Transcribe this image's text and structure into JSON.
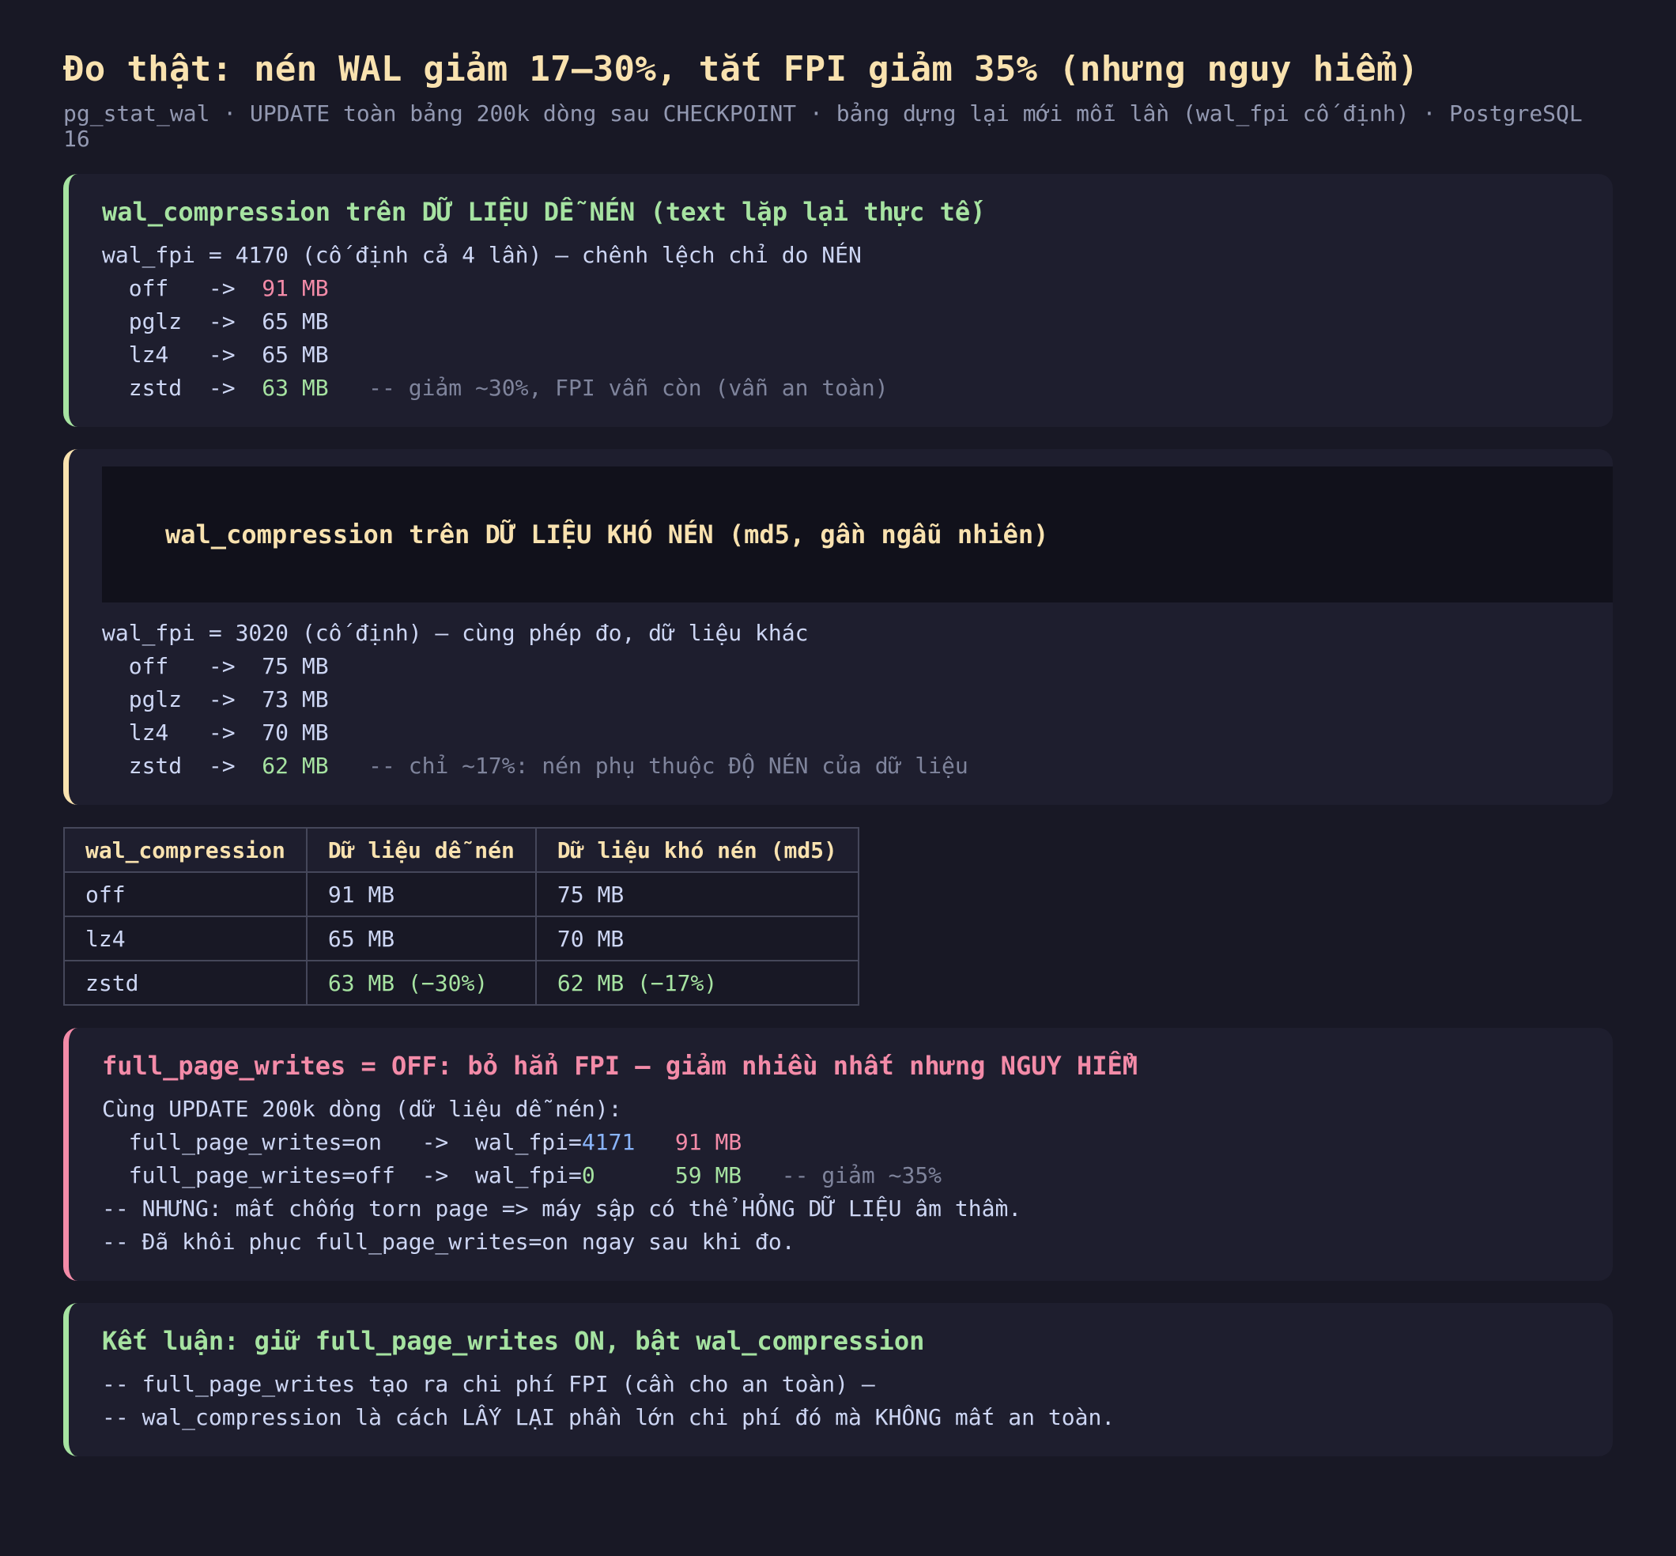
{
  "title": "Đo thật: nén WAL giảm 17–30%, tắt FPI giảm 35% (nhưng nguy hiểm)",
  "subtitle": "pg_stat_wal · UPDATE toàn bảng 200k dòng sau CHECKPOINT · bảng dựng lại mới mỗi lần (wal_fpi cố định) · PostgreSQL 16",
  "card_easy": {
    "title": "wal_compression trên DỮ LIỆU DỄ NÉN (text lặp lại thực tế)",
    "intro": "wal_fpi = 4170 (cố định cả 4 lần) — chênh lệch chỉ do NÉN",
    "rows": [
      {
        "label": "  off   ->  ",
        "value": "91 MB",
        "comment": ""
      },
      {
        "label": "  pglz  ->  ",
        "value": "65 MB",
        "comment": ""
      },
      {
        "label": "  lz4   ->  ",
        "value": "65 MB",
        "comment": ""
      },
      {
        "label": "  zstd  ->  ",
        "value": "63 MB",
        "comment": "   -- giảm ~30%, FPI vẫn còn (vẫn an toàn)"
      }
    ]
  },
  "card_hard": {
    "title": "wal_compression trên DỮ LIỆU KHÓ NÉN (md5, gần ngẫu nhiên)",
    "intro": "wal_fpi = 3020 (cố định) — cùng phép đo, dữ liệu khác",
    "rows": [
      {
        "label": "  off   ->  ",
        "value": "75 MB",
        "comment": ""
      },
      {
        "label": "  pglz  ->  ",
        "value": "73 MB",
        "comment": ""
      },
      {
        "label": "  lz4   ->  ",
        "value": "70 MB",
        "comment": ""
      },
      {
        "label": "  zstd  ->  ",
        "value": "62 MB",
        "comment": "   -- chỉ ~17%: nén phụ thuộc ĐỘ NÉN của dữ liệu"
      }
    ]
  },
  "table": {
    "headers": [
      "wal_compression",
      "Dữ liệu dễ nén",
      "Dữ liệu khó nén (md5)"
    ],
    "rows": [
      [
        "off",
        "91 MB",
        "75 MB"
      ],
      [
        "lz4",
        "65 MB",
        "70 MB"
      ],
      [
        "zstd",
        "63 MB (−30%)",
        "62 MB (−17%)"
      ]
    ]
  },
  "card_fpw": {
    "title": "full_page_writes = OFF: bỏ hẳn FPI — giảm nhiều nhất nhưng NGUY HIỂM",
    "intro": "Cùng UPDATE 200k dòng (dữ liệu dễ nén):",
    "on_prefix": "  full_page_writes=on   ->  wal_fpi=",
    "on_fpi": "4171",
    "on_size": "   91 MB",
    "off_prefix": "  full_page_writes=off  ->  wal_fpi=",
    "off_fpi": "0",
    "off_size": "      59 MB",
    "off_comment": "   -- giảm ~35%",
    "warning": "-- NHƯNG: mất chống torn page => máy sập có thể HỎNG DỮ LIỆU âm thầm.",
    "restored": "-- Đã khôi phục full_page_writes=on ngay sau khi đo."
  },
  "card_conclusion": {
    "title": "Kết luận: giữ full_page_writes ON, bật wal_compression",
    "line1": "-- full_page_writes tạo ra chi phí FPI (cần cho an toàn) —",
    "line2": "-- wal_compression là cách LẤY LẠI phần lớn chi phí đó mà KHÔNG mất an toàn."
  },
  "colors": {
    "background": "#181825",
    "card": "#1e1e2e",
    "green": "#a6e3a1",
    "yellow": "#f9e2af",
    "red": "#f38ba8",
    "blue": "#89b4fa",
    "dim": "#7f849c"
  }
}
